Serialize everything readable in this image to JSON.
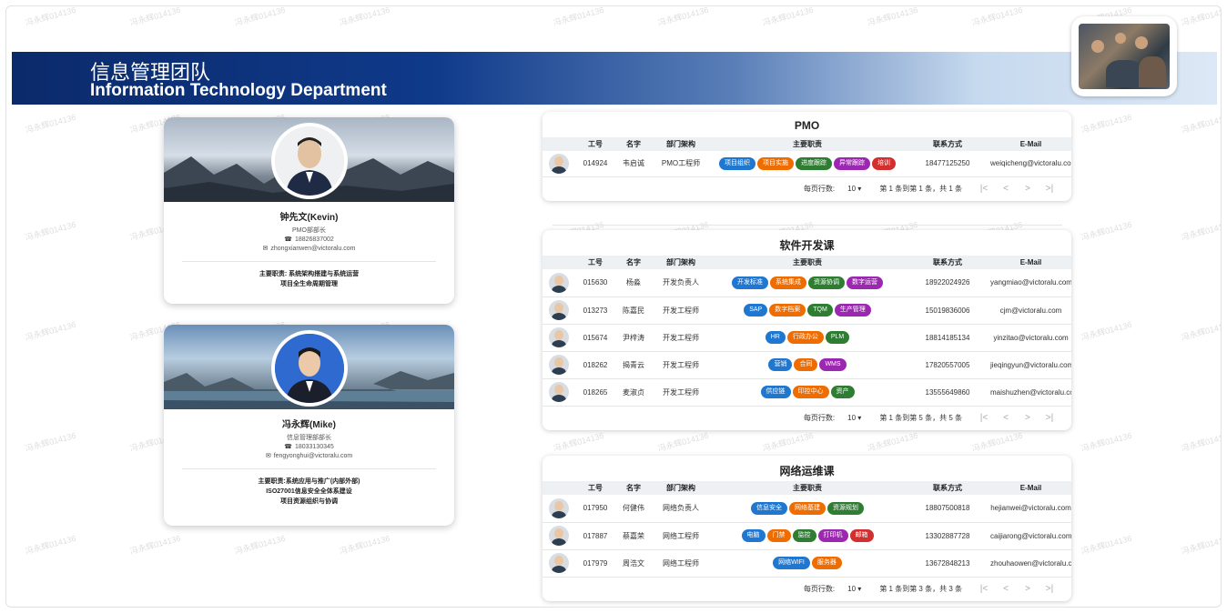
{
  "header": {
    "title_cn": "信息管理团队",
    "title_en": "Information Technology Department"
  },
  "watermark": "冯永辉014136",
  "colors": {
    "blue": "#1f77d0",
    "orange": "#ef6c00",
    "green": "#2e7d32",
    "purple": "#9c27b0",
    "red": "#d32f2f",
    "banner_dark": "#0b2a6b"
  },
  "profiles": [
    {
      "name": "钟先文(Kevin)",
      "role": "PMO部部长",
      "phone": "18826837002",
      "email": "zhongxianwen@victoralu.com",
      "duties": [
        "主要职责: 系统架构搭建与系统运营",
        "项目全生命周期管理"
      ]
    },
    {
      "name": "冯永辉(Mike)",
      "role": "信息管理部部长",
      "phone": "18033130345",
      "email": "fengyonghui@victoralu.com",
      "duties": [
        "主要职责:系统应用与推广(内部外部)",
        "ISO27001信息安全全体系建设",
        "项目资源组织与协调"
      ]
    }
  ],
  "table_headers": {
    "id": "工号",
    "name": "名字",
    "dept": "部门架构",
    "duty": "主要职责",
    "contact": "联系方式",
    "email": "E-Mail"
  },
  "pager": {
    "rows_per_page_label": "每页行数:",
    "rows_per_page": "10 ▾",
    "first": "|<",
    "prev": "<",
    "next": ">",
    "last": ">|"
  },
  "teams": [
    {
      "title": "PMO",
      "range": "第 1 条到第 1 条，共 1 条",
      "rows": [
        {
          "id": "014924",
          "name": "韦启诚",
          "dept": "PMO工程师",
          "tags": [
            [
              "项目组织",
              "blue"
            ],
            [
              "项目实施",
              "orange"
            ],
            [
              "进度跟踪",
              "green"
            ],
            [
              "异常跟踪",
              "purple"
            ],
            [
              "培训",
              "red"
            ]
          ],
          "phone": "18477125250",
          "email": "weiqicheng@victoralu.com"
        }
      ]
    },
    {
      "title": "软件开发课",
      "range": "第 1 条到第 5 条，共 5 条",
      "rows": [
        {
          "id": "015630",
          "name": "杨淼",
          "dept": "开发负责人",
          "tags": [
            [
              "开发标准",
              "blue"
            ],
            [
              "系统集成",
              "orange"
            ],
            [
              "资源协调",
              "green"
            ],
            [
              "数字运营",
              "purple"
            ]
          ],
          "phone": "18922024926",
          "email": "yangmiao@victoralu.com"
        },
        {
          "id": "013273",
          "name": "陈嘉民",
          "dept": "开发工程师",
          "tags": [
            [
              "SAP",
              "blue"
            ],
            [
              "数字档案",
              "orange"
            ],
            [
              "TQM",
              "green"
            ],
            [
              "生产管理",
              "purple"
            ]
          ],
          "phone": "15019836006",
          "email": "cjm@victoralu.com"
        },
        {
          "id": "015674",
          "name": "尹梓涛",
          "dept": "开发工程师",
          "tags": [
            [
              "HR",
              "blue"
            ],
            [
              "行政办公",
              "orange"
            ],
            [
              "PLM",
              "green"
            ]
          ],
          "phone": "18814185134",
          "email": "yinzitao@victoralu.com"
        },
        {
          "id": "018262",
          "name": "揭青云",
          "dept": "开发工程师",
          "tags": [
            [
              "营销",
              "blue"
            ],
            [
              "合同",
              "orange"
            ],
            [
              "WMS",
              "purple"
            ]
          ],
          "phone": "17820557005",
          "email": "jieqingyun@victoralu.com"
        },
        {
          "id": "018265",
          "name": "麦淑贞",
          "dept": "开发工程师",
          "tags": [
            [
              "供应链",
              "blue"
            ],
            [
              "印控中心",
              "orange"
            ],
            [
              "资产",
              "green"
            ]
          ],
          "phone": "13555649860",
          "email": "maishuzhen@victoralu.com"
        }
      ]
    },
    {
      "title": "网络运维课",
      "range": "第 1 条到第 3 条，共 3 条",
      "rows": [
        {
          "id": "017950",
          "name": "何健伟",
          "dept": "网络负责人",
          "tags": [
            [
              "信息安全",
              "blue"
            ],
            [
              "网络基建",
              "orange"
            ],
            [
              "资源规划",
              "green"
            ]
          ],
          "phone": "18807500818",
          "email": "hejianwei@victoralu.com"
        },
        {
          "id": "017887",
          "name": "蔡嘉荣",
          "dept": "网络工程师",
          "tags": [
            [
              "电脑",
              "blue"
            ],
            [
              "门禁",
              "orange"
            ],
            [
              "监控",
              "green"
            ],
            [
              "打印机",
              "purple"
            ],
            [
              "邮箱",
              "red"
            ]
          ],
          "phone": "13302887728",
          "email": "caijiarong@victoralu.com"
        },
        {
          "id": "017979",
          "name": "周浩文",
          "dept": "网络工程师",
          "tags": [
            [
              "网络WIFI",
              "blue"
            ],
            [
              "服务器",
              "orange"
            ]
          ],
          "phone": "13672848213",
          "email": "zhouhaowen@victoralu.com"
        }
      ]
    }
  ]
}
